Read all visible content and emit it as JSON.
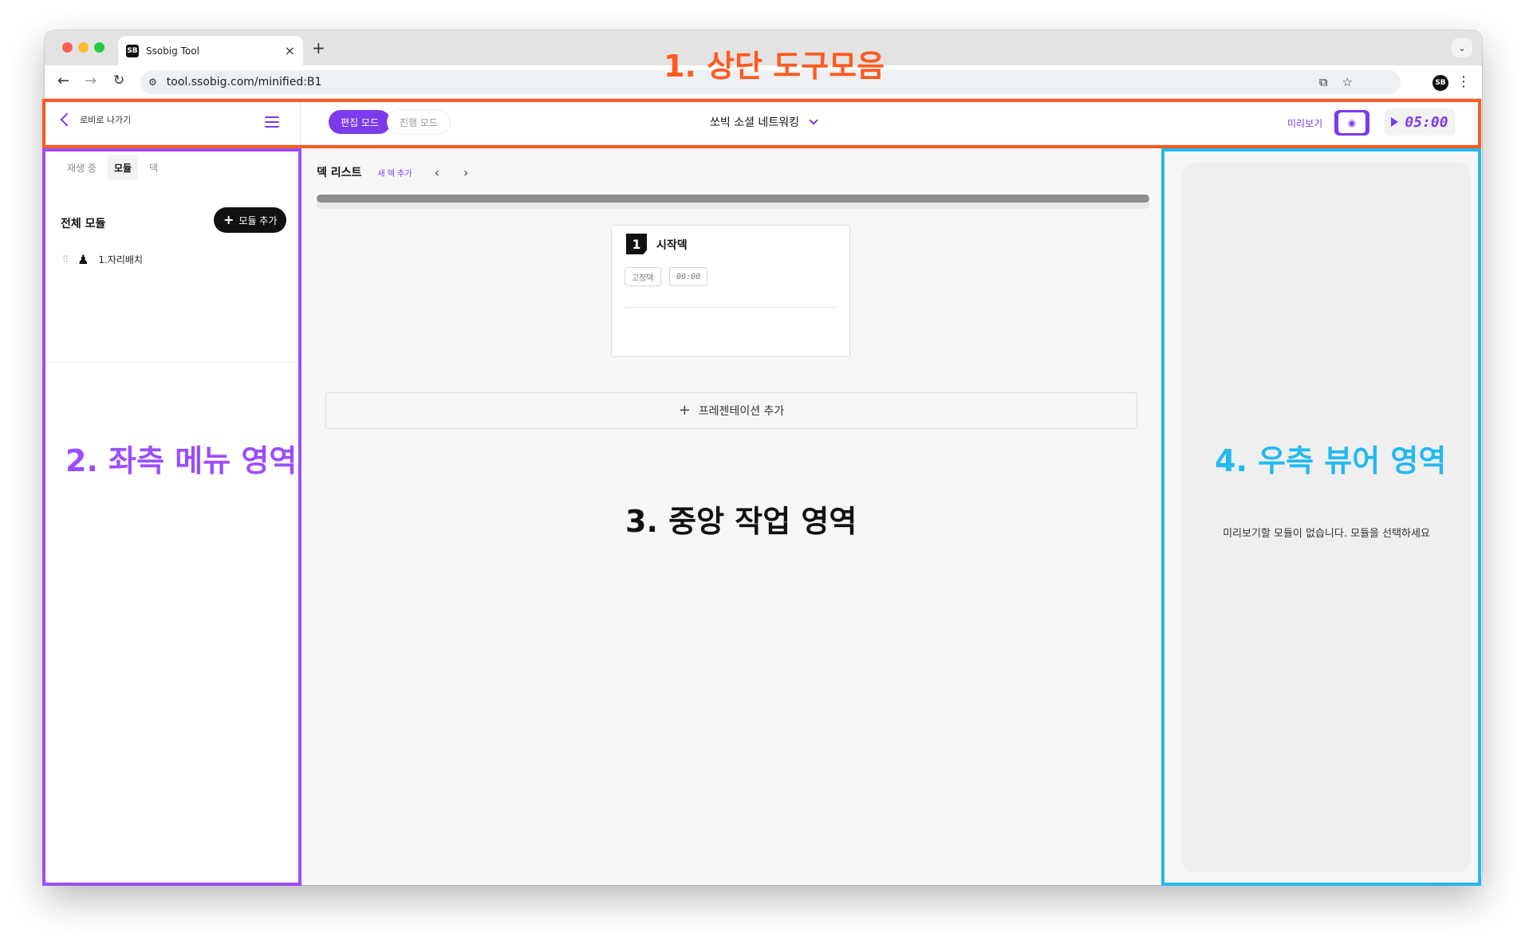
{
  "browser": {
    "tab_title": "Ssobig Tool",
    "tab_close": "×",
    "new_tab": "+",
    "url": "tool.ssobig.com/minified:B1",
    "favicon_text": "SB"
  },
  "appbar": {
    "lobby_label": "로비로 나가기",
    "modes": [
      {
        "label": "편집 모드",
        "active": true
      },
      {
        "label": "진행 모드",
        "active": false
      }
    ],
    "project_title": "쏘빅 소셜 네트워킹",
    "preview_label": "미리보기",
    "timer": "05:00"
  },
  "left_panel": {
    "tabs": [
      {
        "label": "재생 중",
        "active": false
      },
      {
        "label": "모듈",
        "active": true
      },
      {
        "label": "덱",
        "active": false
      }
    ],
    "section_title": "전체 모듈",
    "add_module_label": "모듈 추가",
    "modules": [
      {
        "label": "1.자리배치"
      }
    ]
  },
  "center": {
    "deck_list_label": "덱 리스트",
    "new_deck_label": "새 덱 추가",
    "scroll_fraction": 1.0,
    "deck": {
      "number": "1",
      "name": "시작덱",
      "tag_fixed": "고정덱",
      "tag_time": "00:00"
    },
    "add_presentation_label": "프레젠테이션 추가"
  },
  "right_panel": {
    "empty_message": "미리보기할 모듈이 없습니다. 모듈을 선택하세요"
  },
  "annotations": {
    "label_1": "1. 상단 도구모음",
    "label_2": "2. 좌측 메뉴 영역",
    "label_3": "3. 중앙 작업 영역",
    "label_4": "4. 우측 뷰어 영역",
    "color_1": "#ff5a1f",
    "color_2": "#9c4dff",
    "color_4": "#23b9f2"
  },
  "theme": {
    "accent": "#7c3aed"
  }
}
